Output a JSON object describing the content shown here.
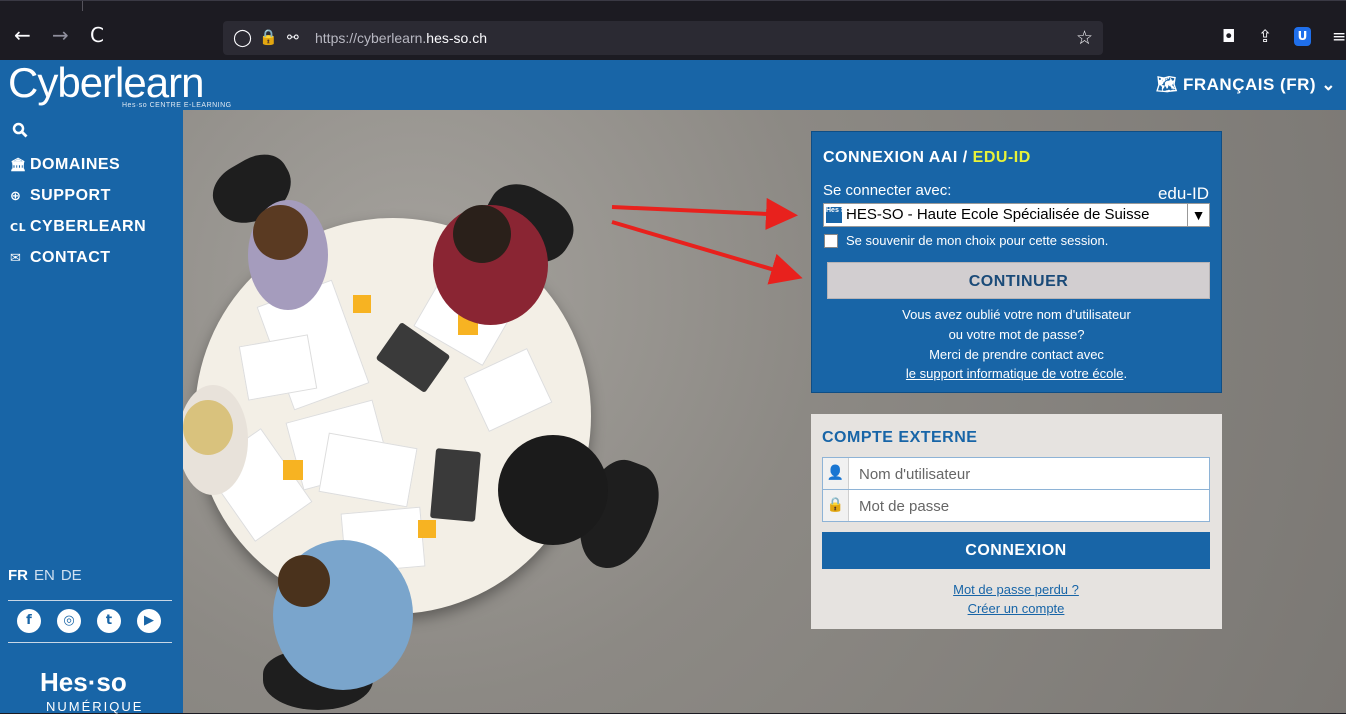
{
  "browser": {
    "url_prefix": "https://cyberlearn.",
    "url_domain": "hes-so.ch",
    "back_icon": "←",
    "forward_icon": "→",
    "reload_icon": "C",
    "shield_icon": "◯",
    "lock_icon": "🔒",
    "tune_icon": "⚯",
    "star_icon": "☆",
    "pocket_icon": "◘",
    "share_icon": "⇪",
    "bitwarden_icon": "U",
    "menu_icon": "≡"
  },
  "header": {
    "logo_text": "Cyberlearn",
    "logo_sub": "Hes·so CENTRE E-LEARNING",
    "language_selector": "🗺 FRANÇAIS (FR) ⌄"
  },
  "sidebar": {
    "search_icon": "🔍",
    "items": [
      {
        "icon": "🏛",
        "label": "DOMAINES"
      },
      {
        "icon": "⊕",
        "label": "SUPPORT"
      },
      {
        "icon": "CL",
        "label": "CYBERLEARN"
      },
      {
        "icon": "✉",
        "label": "CONTACT"
      }
    ],
    "languages": [
      "FR",
      "EN",
      "DE"
    ],
    "social": [
      "f",
      "◎",
      "t",
      "▶"
    ],
    "footer_logo": "Hes·so",
    "footer_sub": "NUMÉRIQUE"
  },
  "login_aai": {
    "title_prefix": "CONNEXION AAI / ",
    "title_highlight": "EDU-ID",
    "label": "Se connecter avec:",
    "eduid_label": "edu-ID",
    "select_value": "HES-SO - Haute Ecole Spécialisée de Suisse",
    "flag_text": "Hes SO",
    "select_caret": "▼",
    "remember_label": "Se souvenir de mon choix pour cette session.",
    "continue_label": "CONTINUER",
    "help_line1": "Vous avez oublié votre nom d'utilisateur",
    "help_line2": "ou votre mot de passe?",
    "help_line3": "Merci de prendre contact avec",
    "help_link": "le support informatique de votre école",
    "help_period": "."
  },
  "external": {
    "title": "COMPTE EXTERNE",
    "username_icon": "👤",
    "username_placeholder": "Nom d'utilisateur",
    "password_icon": "🔒",
    "password_placeholder": "Mot de passe",
    "login_label": "CONNEXION",
    "lost_password": "Mot de passe perdu ?",
    "create_account": "Créer un compte"
  },
  "colors": {
    "primary": "#1865a7",
    "highlight": "#e8f238",
    "arrow": "#e8211d"
  }
}
